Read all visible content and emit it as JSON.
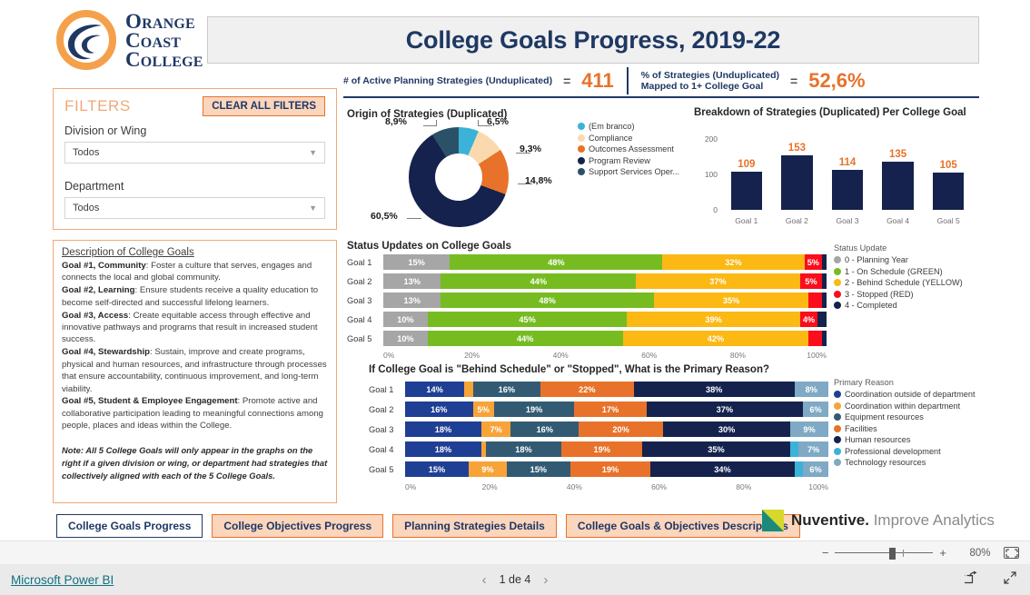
{
  "brand": {
    "logo_line1": "Orange",
    "logo_line2": "Coast",
    "logo_line3": "College",
    "logo_icon": "orange-coast-wave-logo",
    "navy": "#14224d",
    "orange": "#e8722a",
    "light_orange": "#fbd5bc"
  },
  "header": {
    "title": "College Goals Progress, 2019-22"
  },
  "kpis": [
    {
      "label": "# of Active Planning Strategies (Unduplicated)",
      "eq": "=",
      "value": "411"
    },
    {
      "label_line1": "% of Strategies (Unduplicated)",
      "label_line2": "Mapped to 1+ College Goal",
      "eq": "=",
      "value": "52,6%"
    }
  ],
  "filters": {
    "title": "FILTERS",
    "clear_label": "CLEAR ALL FILTERS",
    "fields": [
      {
        "label": "Division or Wing",
        "value": "Todos",
        "icon": "chevron-down-icon"
      },
      {
        "label": "Department",
        "value": "Todos",
        "icon": "chevron-down-icon"
      }
    ]
  },
  "description": {
    "title": "Description of College Goals",
    "goals": [
      {
        "lead": "Goal #1, Community",
        "text": ": Foster a culture that serves, engages and connects the local and global community."
      },
      {
        "lead": "Goal #2, Learning",
        "text": ": Ensure students receive a quality education to become self-directed and successful lifelong learners."
      },
      {
        "lead": "Goal #3, Access",
        "text": ": Create equitable access through effective and innovative pathways and programs that result in increased student success."
      },
      {
        "lead": "Goal #4, Stewardship",
        "text": ": Sustain, improve and create programs, physical and human resources, and infrastructure through processes that ensure accountability, continuous improvement, and long-term viability."
      },
      {
        "lead": "Goal #5, Student & Employee Engagement",
        "text": ": Promote active and collaborative participation leading to meaningful connections among people, places and ideas within the College."
      }
    ],
    "note": "Note: All 5 College Goals will only appear in the graphs on the right if a given division or wing, or department had strategies that collectively aligned with each of the 5 College Goals."
  },
  "chart_data": [
    {
      "type": "pie",
      "name": "origin-of-strategies",
      "title": "Origin of Strategies (Duplicated)",
      "legend_position": "right",
      "labels": [
        "(Em branco)",
        "Compliance",
        "Outcomes Assessment",
        "Program Review",
        "Support Services Oper..."
      ],
      "values": [
        6.5,
        9.3,
        14.8,
        60.5,
        8.9
      ],
      "value_labels": [
        "6,5%",
        "9,3%",
        "14,8%",
        "60,5%",
        "8,9%"
      ],
      "colors": [
        "#3bb3d9",
        "#fbd9ae",
        "#e8722a",
        "#14224d",
        "#2b5169"
      ]
    },
    {
      "type": "bar",
      "name": "breakdown-per-college-goal",
      "title": "Breakdown of Strategies (Duplicated) Per College Goal",
      "categories": [
        "Goal 1",
        "Goal 2",
        "Goal 3",
        "Goal 4",
        "Goal 5"
      ],
      "values": [
        109,
        153,
        114,
        135,
        105
      ],
      "ylim": [
        0,
        200
      ],
      "yticks": [
        0,
        100,
        200
      ],
      "bar_color": "#14224d",
      "label_color": "#e8722a",
      "xlabel": "",
      "ylabel": ""
    },
    {
      "type": "bar",
      "name": "status-updates-on-college-goals",
      "title": "Status Updates on College Goals",
      "orientation": "horizontal",
      "stacked": true,
      "categories": [
        "Goal 1",
        "Goal 2",
        "Goal 3",
        "Goal 4",
        "Goal 5"
      ],
      "legend_title": "Status Update",
      "xticks": [
        "0%",
        "20%",
        "40%",
        "60%",
        "80%",
        "100%"
      ],
      "series": [
        {
          "name": "0 - Planning Year",
          "color": "#a6a6a6",
          "values": [
            15,
            13,
            13,
            10,
            10
          ],
          "labels": [
            "15%",
            "13%",
            "13%",
            "10%",
            "10%"
          ]
        },
        {
          "name": "1 - On Schedule (GREEN)",
          "color": "#76bc21",
          "values": [
            48,
            44,
            48,
            45,
            44
          ],
          "labels": [
            "48%",
            "44%",
            "48%",
            "45%",
            "44%"
          ]
        },
        {
          "name": "2 - Behind Schedule (YELLOW)",
          "color": "#fcb813",
          "values": [
            32,
            37,
            35,
            39,
            42
          ],
          "labels": [
            "32%",
            "37%",
            "35%",
            "39%",
            "42%"
          ]
        },
        {
          "name": "3 - Stopped (RED)",
          "color": "#fb0d1b",
          "values": [
            4,
            5,
            3,
            4,
            3
          ],
          "labels": [
            "5%",
            "5%",
            "",
            "4%",
            ""
          ]
        },
        {
          "name": "4 - Completed",
          "color": "#14224d",
          "values": [
            1,
            1,
            1,
            2,
            1
          ],
          "labels": [
            "",
            "",
            "",
            "",
            ""
          ]
        }
      ]
    },
    {
      "type": "bar",
      "name": "primary-reason-behind-schedule-or-stopped",
      "title": "If College Goal is \"Behind Schedule\" or \"Stopped\", What is the Primary Reason?",
      "orientation": "horizontal",
      "stacked": true,
      "categories": [
        "Goal 1",
        "Goal 2",
        "Goal 3",
        "Goal 4",
        "Goal 5"
      ],
      "legend_title": "Primary Reason",
      "xticks": [
        "0%",
        "20%",
        "40%",
        "60%",
        "80%",
        "100%"
      ],
      "series": [
        {
          "name": "Coordination outside of department",
          "color": "#1f3f94",
          "values": [
            14,
            16,
            18,
            18,
            15
          ],
          "labels": [
            "14%",
            "16%",
            "18%",
            "18%",
            "15%"
          ]
        },
        {
          "name": "Coordination within department",
          "color": "#f7a338",
          "values": [
            2,
            5,
            7,
            1,
            9
          ],
          "labels": [
            "",
            "5%",
            "7%",
            "",
            "9%"
          ]
        },
        {
          "name": "Equipment resources",
          "color": "#325b73",
          "values": [
            16,
            19,
            16,
            18,
            15
          ],
          "labels": [
            "16%",
            "19%",
            "16%",
            "18%",
            "15%"
          ]
        },
        {
          "name": "Facilities",
          "color": "#e8722a",
          "values": [
            22,
            17,
            20,
            19,
            19
          ],
          "labels": [
            "22%",
            "17%",
            "20%",
            "19%",
            "19%"
          ]
        },
        {
          "name": "Human resources",
          "color": "#14224d",
          "values": [
            38,
            37,
            30,
            35,
            34
          ],
          "labels": [
            "38%",
            "37%",
            "30%",
            "35%",
            "34%"
          ]
        },
        {
          "name": "Professional development",
          "color": "#3bb3d9",
          "values": [
            0,
            0,
            0,
            2,
            2
          ],
          "labels": [
            "",
            "",
            "",
            "",
            ""
          ]
        },
        {
          "name": "Technology resources",
          "color": "#7fa9c4",
          "values": [
            8,
            6,
            9,
            7,
            6
          ],
          "labels": [
            "8%",
            "6%",
            "9%",
            "7%",
            "6%"
          ]
        }
      ]
    }
  ],
  "tabs": [
    {
      "label": "College Goals Progress",
      "active": true
    },
    {
      "label": "College Objectives Progress",
      "active": false
    },
    {
      "label": "Planning Strategies Details",
      "active": false
    },
    {
      "label": "College Goals & Objectives Descriptions",
      "active": false
    }
  ],
  "nuventive": {
    "name": "Nuventive.",
    "tagline": " Improve Analytics",
    "icon": "nuventive-logo"
  },
  "zoombar": {
    "minus": "−",
    "plus": "+",
    "percent": "80%",
    "fit_icon": "fit-to-page-icon"
  },
  "statusbar": {
    "powerbi_label": "Microsoft Power BI",
    "prev_icon": "chevron-left-icon",
    "next_icon": "chevron-right-icon",
    "page_label": "1 de 4",
    "share_icon": "share-icon",
    "fullscreen_icon": "fullscreen-icon"
  }
}
